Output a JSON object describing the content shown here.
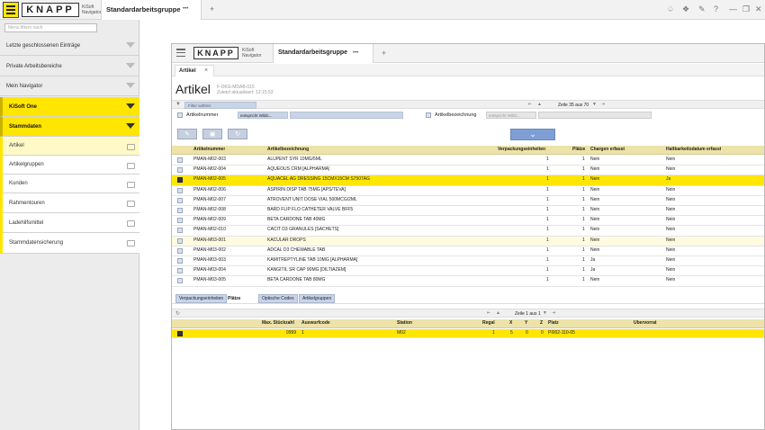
{
  "topbar": {
    "logo": "KNAPP",
    "app_name": "KiSoft",
    "app_sub": "Navigator",
    "tab_title": "Standardarbeitsgruppe",
    "tab_more": "•••",
    "add_tab": "+",
    "icons": [
      "bell-icon",
      "pin-icon",
      "brush-icon",
      "help-icon",
      "minimize-icon",
      "restore-icon",
      "close-icon"
    ]
  },
  "sidebar": {
    "search_placeholder": "Menü filtern nach",
    "items": [
      {
        "label": "Letzte geschlossenen Einträge"
      },
      {
        "label": "Private Arbeitsbereiche"
      },
      {
        "label": "Mein Navigator"
      },
      {
        "label": "KiSoft One"
      },
      {
        "label": "Stammdaten"
      }
    ],
    "sub_items": [
      {
        "label": "Artikel"
      },
      {
        "label": "Artikelgruppen"
      },
      {
        "label": "Kunden"
      },
      {
        "label": "Rahmentouren"
      },
      {
        "label": "Ladehilfsmittel"
      },
      {
        "label": "Stammdatensicherung"
      }
    ]
  },
  "window": {
    "logo": "KNAPP",
    "app_name": "KiSoft",
    "app_sub": "Navigator",
    "tab_title": "Standardarbeitsgruppe",
    "tab_more": "•••",
    "add_tab": "+",
    "subtab": "Artikel",
    "subtab_close": "×",
    "page_title": "Artikel",
    "meta_id": "F-DKG-MDAB-015",
    "meta_updated": "Zuletzt aktualisiert: 12:15:53",
    "filter_placeholder": "Filter wählen",
    "pager": "Zeile 35 aus 70",
    "filter1_label": "Artikelnummer",
    "filter1_op": "entspricht Wildc...",
    "filter2_label": "Artikelbezeichnung",
    "filter2_op": "entspricht Wildc...",
    "expand_label": "⌄",
    "columns": [
      "Artikelnummer",
      "Artikelbezeichnung",
      "Verpackungseinheiten",
      "Plätze",
      "Chargen erfasst",
      "Haltbarkeitsdatum erfasst"
    ],
    "rows": [
      {
        "nr": "PMAN-M02-003",
        "bez": "ALUPENT SYR 10MG/5ML",
        "vpe": "1",
        "pl": "1",
        "ch": "Nein",
        "hb": "Nein",
        "sel": false
      },
      {
        "nr": "PMAN-M02-004",
        "bez": "AQUEOUS CRM [ALPHARMA]",
        "vpe": "1",
        "pl": "1",
        "ch": "Nein",
        "hb": "Nein",
        "sel": false
      },
      {
        "nr": "PMAN-M02-005",
        "bez": "AQUACEL AG DRESSING 15CMX15CM S7507AG",
        "vpe": "1",
        "pl": "1",
        "ch": "Nein",
        "hb": "Ja",
        "sel": true
      },
      {
        "nr": "PMAN-M02-006",
        "bez": "ASPIRIN DISP TAB 75MG [APS/TEVA]",
        "vpe": "1",
        "pl": "1",
        "ch": "Nein",
        "hb": "Nein",
        "sel": false
      },
      {
        "nr": "PMAN-M02-007",
        "bez": "ATROVENT UNIT DOSE VIAL 500MCG/2ML",
        "vpe": "1",
        "pl": "1",
        "ch": "Nein",
        "hb": "Nein",
        "sel": false
      },
      {
        "nr": "PMAN-M02-008",
        "bez": "BARD FLIP FLO CATHETER VALVE BFF5",
        "vpe": "1",
        "pl": "1",
        "ch": "Nein",
        "hb": "Nein",
        "sel": false
      },
      {
        "nr": "PMAN-M02-009",
        "bez": "BETA CARDONE TAB 40MG",
        "vpe": "1",
        "pl": "1",
        "ch": "Nein",
        "hb": "Nein",
        "sel": false
      },
      {
        "nr": "PMAN-M02-010",
        "bez": "CACIT D3 GRANULES [SACHETS]",
        "vpe": "1",
        "pl": "1",
        "ch": "Nein",
        "hb": "Nein",
        "sel": false
      },
      {
        "nr": "PMAN-M03-001",
        "bez": "KACULAR DROPS",
        "vpe": "1",
        "pl": "1",
        "ch": "Nein",
        "hb": "Nein",
        "sel": false,
        "alt": true
      },
      {
        "nr": "PMAN-M03-002",
        "bez": "ADCAL D3 CHEWABLE TAB",
        "vpe": "1",
        "pl": "1",
        "ch": "Nein",
        "hb": "Nein",
        "sel": false
      },
      {
        "nr": "PMAN-M03-003",
        "bez": "KAMITREPTYLINE TAB 10MG [ALPHARMA]",
        "vpe": "1",
        "pl": "1",
        "ch": "Ja",
        "hb": "Nein",
        "sel": false
      },
      {
        "nr": "PMAN-M03-004",
        "bez": "KANGITIL SR CAP 90MG [DILTIAZEM]",
        "vpe": "1",
        "pl": "1",
        "ch": "Ja",
        "hb": "Nein",
        "sel": false
      },
      {
        "nr": "PMAN-M03-005",
        "bez": "BETA CARDONE TAB 80MG",
        "vpe": "1",
        "pl": "1",
        "ch": "Nein",
        "hb": "Nein",
        "sel": false
      }
    ],
    "detail_tabs": [
      "Verpackungseinheiten",
      "Plätze",
      "Optische Codes",
      "Artikelgruppen"
    ],
    "detail_pager": "Zeile 1 aus 1",
    "detail_columns": [
      "Max. Stückzahl",
      "Auswurfcode",
      "Station",
      "Regal",
      "X",
      "Y",
      "Z",
      "Platz",
      "Übervorrat"
    ],
    "detail_rows": [
      {
        "max": "9999",
        "aus": "1",
        "station": "M02",
        "regal": "1",
        "x": "5",
        "y": "0",
        "z": "0",
        "platz": "PI002-110-05",
        "ueber": ""
      }
    ]
  },
  "colors": {
    "accent": "#ffe600",
    "header": "#ede2a8",
    "button": "#7f9fd4"
  }
}
